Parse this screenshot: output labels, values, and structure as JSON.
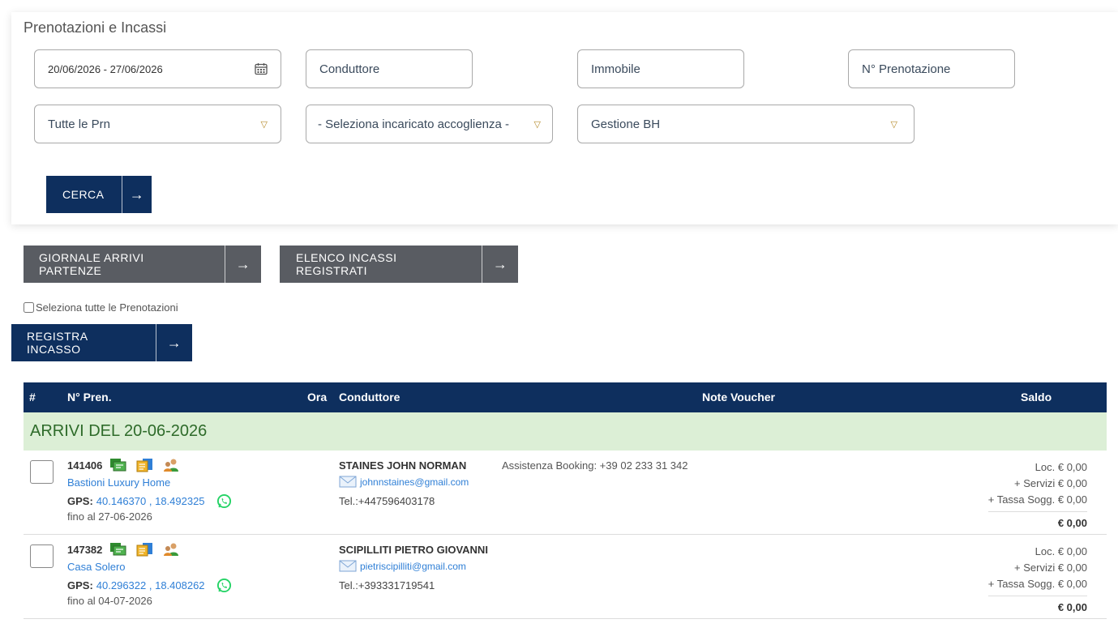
{
  "panel": {
    "title": "Prenotazioni e Incassi",
    "date_range": "20/06/2026 - 27/06/2026",
    "conduttore_placeholder": "Conduttore",
    "immobile_placeholder": "Immobile",
    "prenotazione_placeholder": "N° Prenotazione",
    "select_prn": "Tutte le Prn",
    "select_incaricato": "- Seleziona incaricato accoglienza -",
    "select_gestione": "Gestione BH",
    "search_label": "CERCA"
  },
  "actions": {
    "giornale_label": "GIORNALE ARRIVI PARTENZE",
    "elenco_label": "ELENCO INCASSI REGISTRATI",
    "select_all_label": "Seleziona tutte le Prenotazioni",
    "registra_label": "REGISTRA INCASSO",
    "arrow": "→"
  },
  "table": {
    "headers": {
      "hash": "#",
      "pren": "N° Pren.",
      "ora": "Ora",
      "conduttore": "Conduttore",
      "note": "Note Voucher",
      "saldo": "Saldo"
    },
    "group_title": "ARRIVI DEL  20-06-2026",
    "rows": [
      {
        "num": "141406",
        "property": "Bastioni Luxury Home",
        "gps_label": "GPS:",
        "gps": "40.146370 , 18.492325",
        "fino": "fino al 27-06-2026",
        "name": "STAINES JOHN NORMAN",
        "email": "johnnstaines@gmail.com",
        "tel": "Tel.:+447596403178",
        "note": "Assistenza Booking: +39 02 233 31 342",
        "loc": "Loc. € 0,00",
        "servizi": "+ Servizi € 0,00",
        "tassa": "+ Tassa Sogg. € 0,00",
        "total": "€ 0,00"
      },
      {
        "num": "147382",
        "property": "Casa Solero",
        "gps_label": "GPS:",
        "gps": "40.296322 , 18.408262",
        "fino": "fino al 04-07-2026",
        "name": "SCIPILLITI PIETRO GIOVANNI",
        "email": "pietriscipilliti@gmail.com",
        "tel": "Tel.:+393331719541",
        "note": "",
        "loc": "Loc. € 0,00",
        "servizi": "+ Servizi € 0,00",
        "tassa": "+ Tassa Sogg. € 0,00",
        "total": "€ 0,00"
      }
    ]
  },
  "icons": {
    "calendar": "calendar-icon",
    "dropdown": "chevron-down-icon",
    "arrow": "arrow-right-icon",
    "card": "card-icon",
    "document": "documents-icon",
    "users": "users-icon",
    "whatsapp": "whatsapp-icon",
    "email": "envelope-icon"
  },
  "colors": {
    "navy": "#0e2f5e",
    "grey": "#595c62",
    "group_bg": "#dcefd6",
    "group_text": "#2e6b2a",
    "link": "#2f7fd6",
    "whatsapp": "#25d366"
  }
}
